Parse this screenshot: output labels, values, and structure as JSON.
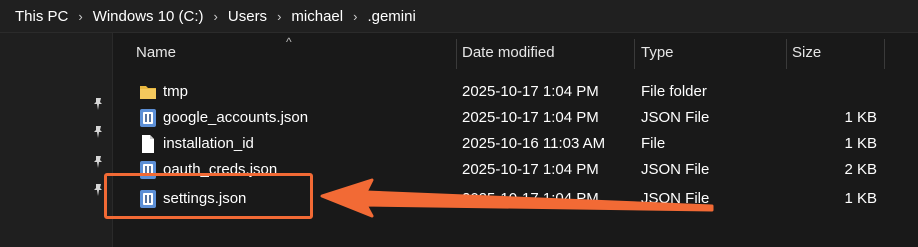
{
  "breadcrumb": [
    {
      "label": "This PC"
    },
    {
      "label": "Windows 10 (C:)"
    },
    {
      "label": "Users"
    },
    {
      "label": "michael"
    },
    {
      "label": ".gemini"
    }
  ],
  "columns": {
    "name": "Name",
    "date": "Date modified",
    "type": "Type",
    "size": "Size"
  },
  "files": [
    {
      "name": "tmp",
      "date": "2025-10-17 1:04 PM",
      "type": "File folder",
      "size": "",
      "icon": "folder-icon"
    },
    {
      "name": "google_accounts.json",
      "date": "2025-10-17 1:04 PM",
      "type": "JSON File",
      "size": "1 KB",
      "icon": "json-file-icon"
    },
    {
      "name": "installation_id",
      "date": "2025-10-16 11:03 AM",
      "type": "File",
      "size": "1 KB",
      "icon": "file-icon"
    },
    {
      "name": "oauth_creds.json",
      "date": "2025-10-17 1:04 PM",
      "type": "JSON File",
      "size": "2 KB",
      "icon": "json-file-icon"
    },
    {
      "name": "settings.json",
      "date": "2025-10-17 1:04 PM",
      "type": "JSON File",
      "size": "1 KB",
      "icon": "json-file-icon"
    }
  ],
  "colors": {
    "background": "#191919",
    "annotation": "#f26a35"
  }
}
